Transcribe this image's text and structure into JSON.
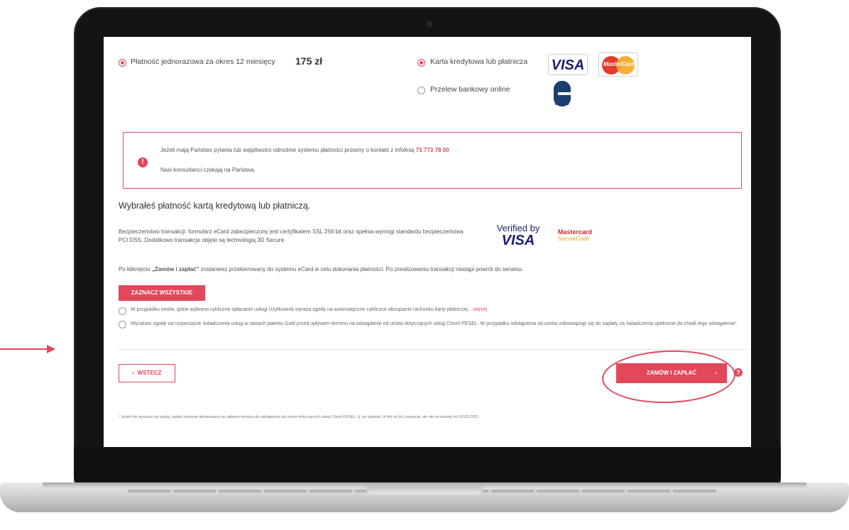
{
  "payment": {
    "one_time_label": "Płatność jednorazowa za okres 12 miesięcy",
    "price": "175 zł",
    "card_label": "Karta kredytowa lub płatnicza",
    "transfer_label": "Przelew bankowy online",
    "visa_logo": "VISA",
    "mastercard_logo": "MasterCard",
    "ecard_logo": "CARD"
  },
  "info": {
    "line1": "Jeżeli mają Państwo pytania lub wątpliwości odnośnie systemu płatności prosimy o kontakt z infolinią",
    "phone": "71 773 78 00",
    "line2": "Nasi konsultanci czekają na Państwa.",
    "icon": "!"
  },
  "selected": {
    "heading": "Wybrałeś płatność kartą kredytową lub płatniczą.",
    "security_text": "Bezpieczeństwo transakcji: formularz eCard zabezpieczony jest certyfikatem SSL 256 bit oraz spełnia wymogi standardu bezpieczeństwa PCI DSS. Dodatkowo transakcje objęte są technologią 3D Secure.",
    "verified_by": "Verified by",
    "verified_visa": "VISA",
    "mc_securecode_1": "Mastercard",
    "mc_securecode_2": "SecureCode",
    "redirect_pre": "Po kliknięciu ",
    "redirect_bold": "„Zamów i zapłać”",
    "redirect_post": " zostaniesz przekierowany do systemu eCard w celu dokonania płatności. Po zrealizowaniu transakcji nastąpi powrót do serwisu."
  },
  "consents": {
    "select_all": "ZAZNACZ WSZYSTKIE",
    "consent1": "W przypadku umów, gdzie wybrano cykliczne opłacanie usługi Użytkownik wyraża zgodę na automatyczne cykliczne obciążanie rachunku karty płatniczej",
    "more": "...więcej",
    "consent2": "Wyrażam zgodę na rozpoczęcie świadczenia usług w ramach pakietu Gold przed upływem terminu na odstąpienie od umów dotyczących usług Chroń PESEL. W przypadku odstąpienia od umów zobowiązuję się do zapłaty za świadczenia spełnione do chwili tego odstąpienia¹."
  },
  "actions": {
    "back_label": "WSTECZ",
    "back_icon": "‹",
    "order_label": "ZAMÓW I ZAPŁAĆ",
    "order_icon": "›",
    "help_icon": "?"
  },
  "footnote": "¹ Jeżeli nie wyrazisz tej zgody, pakiet zostanie aktywowany po upływie terminu do odstąpienia od umów dotyczących usług Chroń PESEL, tj. po upływie 14 dni od ich zawarcia, ale nie wcześniej niż 03.03.2021.",
  "colors": {
    "accent": "#e2475a",
    "text": "#454545"
  }
}
